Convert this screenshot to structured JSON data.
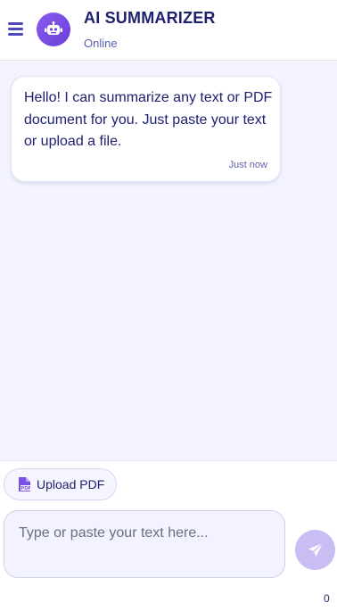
{
  "header": {
    "title": "AI SUMMARIZER",
    "status": "Online",
    "menu_icon": "hamburger-menu-icon",
    "avatar_icon": "robot-icon"
  },
  "chat": {
    "messages": [
      {
        "text": "Hello! I can summarize any text or PDF document for you. Just paste your text or upload a file.",
        "time": "Just now"
      }
    ]
  },
  "composer": {
    "upload_label": "Upload PDF",
    "upload_icon": "pdf-file-icon",
    "placeholder": "Type or paste your text here...",
    "value": "",
    "send_icon": "send-paper-plane-icon",
    "char_count": "0"
  },
  "colors": {
    "accent": "#7a4fe6",
    "title": "#1e1f6e",
    "chat_background": "#f3f4ff",
    "send_disabled": "#c9bdf3"
  }
}
